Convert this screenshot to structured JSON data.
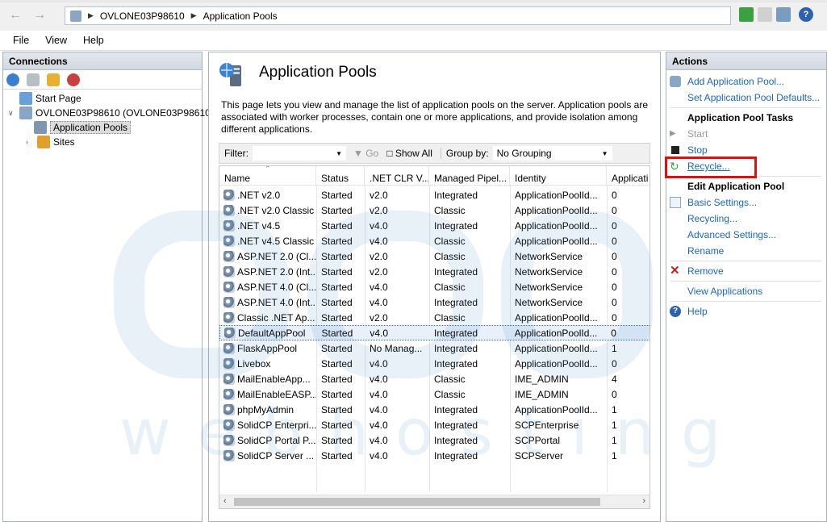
{
  "address": {
    "segments": [
      "OVLONE03P98610",
      "Application Pools"
    ]
  },
  "menu": [
    "File",
    "View",
    "Help"
  ],
  "connections": {
    "title": "Connections",
    "tree": [
      {
        "label": "Start Page"
      },
      {
        "label": "OVLONE03P98610 (OVLONE03P98610\\"
      },
      {
        "label": "Application Pools"
      },
      {
        "label": "Sites"
      }
    ]
  },
  "center": {
    "title": "Application Pools",
    "description": "This page lets you view and manage the list of application pools on the server. Application pools are associated with worker processes, contain one or more applications, and provide isolation among different applications.",
    "filter": {
      "label": "Filter:",
      "go": "Go",
      "show_all": "Show All",
      "group_by_label": "Group by:",
      "group_by_value": "No Grouping"
    },
    "columns": [
      "Name",
      "Status",
      ".NET CLR V...",
      "Managed Pipel...",
      "Identity",
      "Applicati"
    ],
    "rows": [
      [
        ".NET v2.0",
        "Started",
        "v2.0",
        "Integrated",
        "ApplicationPoolId...",
        "0"
      ],
      [
        ".NET v2.0 Classic",
        "Started",
        "v2.0",
        "Classic",
        "ApplicationPoolId...",
        "0"
      ],
      [
        ".NET v4.5",
        "Started",
        "v4.0",
        "Integrated",
        "ApplicationPoolId...",
        "0"
      ],
      [
        ".NET v4.5 Classic",
        "Started",
        "v4.0",
        "Classic",
        "ApplicationPoolId...",
        "0"
      ],
      [
        "ASP.NET 2.0 (Cl...",
        "Started",
        "v2.0",
        "Classic",
        "NetworkService",
        "0"
      ],
      [
        "ASP.NET 2.0 (Int...",
        "Started",
        "v2.0",
        "Integrated",
        "NetworkService",
        "0"
      ],
      [
        "ASP.NET 4.0 (Cl...",
        "Started",
        "v4.0",
        "Classic",
        "NetworkService",
        "0"
      ],
      [
        "ASP.NET 4.0 (Int...",
        "Started",
        "v4.0",
        "Integrated",
        "NetworkService",
        "0"
      ],
      [
        "Classic .NET Ap...",
        "Started",
        "v2.0",
        "Classic",
        "ApplicationPoolId...",
        "0"
      ],
      [
        "DefaultAppPool",
        "Started",
        "v4.0",
        "Integrated",
        "ApplicationPoolId...",
        "0"
      ],
      [
        "FlaskAppPool",
        "Started",
        "No Manag...",
        "Integrated",
        "ApplicationPoolId...",
        "1"
      ],
      [
        "Livebox",
        "Started",
        "v4.0",
        "Integrated",
        "ApplicationPoolId...",
        "0"
      ],
      [
        "MailEnableApp...",
        "Started",
        "v4.0",
        "Classic",
        "IME_ADMIN",
        "4"
      ],
      [
        "MailEnableEASP...",
        "Started",
        "v4.0",
        "Classic",
        "IME_ADMIN",
        "0"
      ],
      [
        "phpMyAdmin",
        "Started",
        "v4.0",
        "Integrated",
        "ApplicationPoolId...",
        "1"
      ],
      [
        "SolidCP Enterpri...",
        "Started",
        "v4.0",
        "Integrated",
        "SCPEnterprise",
        "1"
      ],
      [
        "SolidCP Portal P...",
        "Started",
        "v4.0",
        "Integrated",
        "SCPPortal",
        "1"
      ],
      [
        "SolidCP Server ...",
        "Started",
        "v4.0",
        "Integrated",
        "SCPServer",
        "1"
      ]
    ],
    "selected_row": "DefaultAppPool"
  },
  "actions": {
    "title": "Actions",
    "add_pool": "Add Application Pool...",
    "set_defaults": "Set Application Pool Defaults...",
    "tasks_heading": "Application Pool Tasks",
    "start": "Start",
    "stop": "Stop",
    "recycle": "Recycle...",
    "edit_heading": "Edit Application Pool",
    "basic_settings": "Basic Settings...",
    "recycling": "Recycling...",
    "advanced_settings": "Advanced Settings...",
    "rename": "Rename",
    "remove": "Remove",
    "view_applications": "View Applications",
    "help": "Help"
  },
  "watermark": {
    "line2": "w e b h o s t i n g"
  }
}
